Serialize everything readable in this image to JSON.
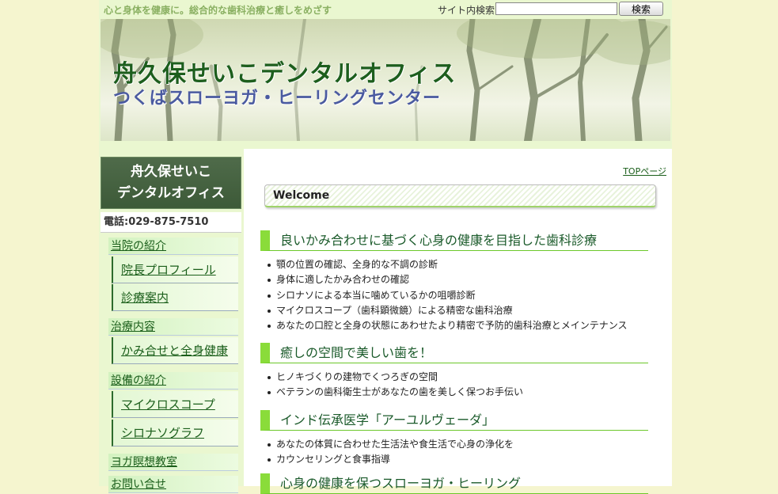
{
  "header": {
    "tagline": "心と身体を健康に。総合的な歯科治療と癒しをめざす",
    "search_label": "サイト内検索",
    "search_value": "",
    "search_button": "検索",
    "site_title": "舟久保せいこデンタルオフィス",
    "site_subtitle": "つくばスローヨガ・ヒーリングセンター"
  },
  "sidebar": {
    "logo_line1": "舟久保せいこ",
    "logo_line2": "デンタルオフィス",
    "phone": "電話:029-875-7510",
    "nav": [
      {
        "label": "当院の紹介",
        "children": [
          "院長プロフィール",
          "診療案内"
        ]
      },
      {
        "label": "治療内容",
        "children": [
          "かみ合せと全身健康"
        ]
      },
      {
        "label": "設備の紹介",
        "children": [
          "マイクロスコープ",
          "シロナソグラフ"
        ]
      },
      {
        "label": "ヨガ瞑想教室",
        "children": []
      },
      {
        "label": "お問い合せ",
        "children": []
      }
    ]
  },
  "main": {
    "top_link": "TOPページ",
    "welcome": "Welcome",
    "sections": [
      {
        "title": "良いかみ合わせに基づく心身の健康を目指した歯科診療",
        "items": [
          "顎の位置の確認、全身的な不調の診断",
          "身体に適したかみ合わせの確認",
          "シロナソによる本当に噛めているかの咀嚼診断",
          "マイクロスコープ（歯科顕微鏡）による精密な歯科治療",
          "あなたの口腔と全身の状態にあわせたより精密で予防的歯科治療とメインテナンス"
        ]
      },
      {
        "title": "癒しの空間で美しい歯を！",
        "items": [
          "ヒノキづくりの建物でくつろぎの空間",
          "ベテランの歯科衛生士があなたの歯を美しく保つお手伝い"
        ]
      },
      {
        "title": "インド伝承医学「アーユルヴェーダ」",
        "items": [
          "あなたの体質に合わせた生活法や食生活で心身の浄化を",
          "カウンセリングと食事指導"
        ]
      },
      {
        "title": "心身の健康を保つスローヨガ・ヒーリング",
        "items": []
      }
    ]
  },
  "colors": {
    "accent_green": "#8adc3a",
    "nav_text": "#1a5e1a",
    "logo_bg": "#3d5a38",
    "page_bg": "#f5f5cf"
  }
}
